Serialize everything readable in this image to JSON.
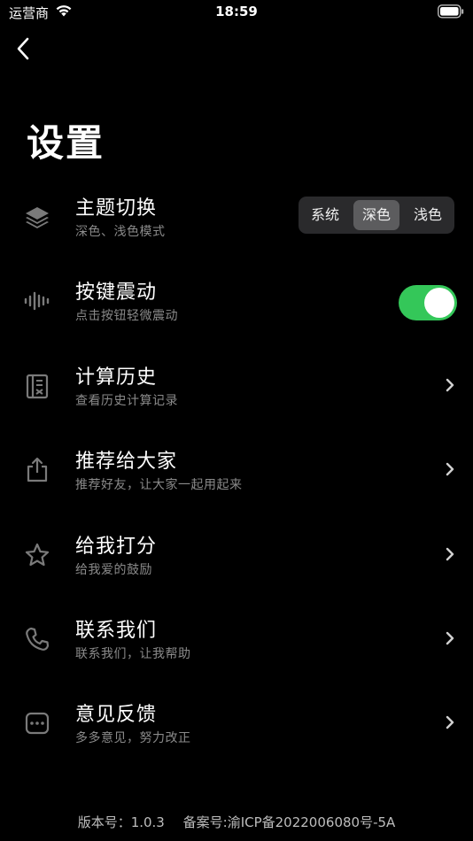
{
  "status_bar": {
    "carrier": "运营商",
    "time": "18:59"
  },
  "page": {
    "title": "设置"
  },
  "theme_row": {
    "title": "主题切换",
    "subtitle": "深色、浅色模式",
    "icon": "layers-icon",
    "options": [
      "系统",
      "深色",
      "浅色"
    ],
    "selected": "深色"
  },
  "vibration_row": {
    "title": "按键震动",
    "subtitle": "点击按钮轻微震动",
    "icon": "waveform-icon",
    "enabled": true,
    "toggle_color": "#34c759"
  },
  "rows": [
    {
      "title": "计算历史",
      "subtitle": "查看历史计算记录",
      "icon": "history-icon"
    },
    {
      "title": "推荐给大家",
      "subtitle": "推荐好友，让大家一起用起来",
      "icon": "share-icon"
    },
    {
      "title": "给我打分",
      "subtitle": "给我爱的鼓励",
      "icon": "star-icon"
    },
    {
      "title": "联系我们",
      "subtitle": "联系我们，让我帮助",
      "icon": "phone-icon"
    },
    {
      "title": "意见反馈",
      "subtitle": "多多意见，努力改正",
      "icon": "feedback-icon"
    }
  ],
  "footer": {
    "version": "版本号：1.0.3",
    "icp": "备案号:渝ICP备2022006080号-5A"
  }
}
